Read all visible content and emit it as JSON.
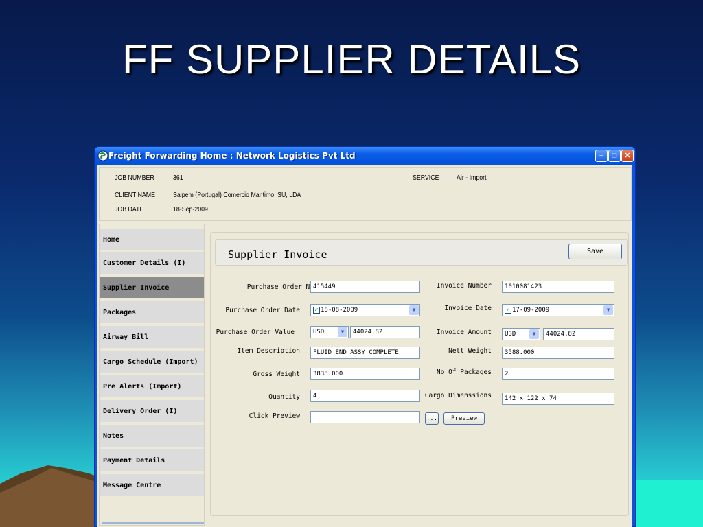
{
  "slide": {
    "title": "FF SUPPLIER DETAILS"
  },
  "window": {
    "title": "Freight Forwarding Home  :  Network Logistics Pvt Ltd",
    "minimize": "–",
    "maximize": "□",
    "close": "✕"
  },
  "job": {
    "number_label": "JOB NUMBER",
    "number": "361",
    "client_label": "CLIENT NAME",
    "client": "Saipem (Portugal) Comercio Maritimo, SU, LDA",
    "date_label": "JOB DATE",
    "date": "18-Sep-2009",
    "service_label": "SERVICE",
    "service": "Air - Import"
  },
  "sidebar": {
    "items": [
      {
        "label": "Home"
      },
      {
        "label": "Customer Details (I)"
      },
      {
        "label": "Supplier Invoice",
        "active": true
      },
      {
        "label": "Packages"
      },
      {
        "label": "Airway Bill"
      },
      {
        "label": "Cargo Schedule (Import)"
      },
      {
        "label": "Pre Alerts (Import)"
      },
      {
        "label": "Delivery Order (I)"
      },
      {
        "label": "Notes"
      },
      {
        "label": "Payment Details"
      },
      {
        "label": "Message Centre"
      }
    ]
  },
  "form": {
    "title": "Supplier Invoice",
    "save_label": "Save",
    "po_no_label": "Purchase Order No",
    "po_no": "415449",
    "po_date_label": "Purchase Order Date",
    "po_date": "18-08-2009",
    "po_value_label": "Purchase Order Value",
    "po_currency": "USD",
    "po_value": "44024.82",
    "item_desc_label": "Item Description",
    "item_desc": "FLUID END ASSY COMPLETE",
    "gross_weight_label": "Gross Weight",
    "gross_weight": "3838.000",
    "quantity_label": "Quantity",
    "quantity": "4",
    "click_preview_label": "Click Preview",
    "preview_path": "",
    "browse_label": "...",
    "preview_label": "Preview",
    "invoice_no_label": "Invoice Number",
    "invoice_no": "1010081423",
    "invoice_date_label": "Invoice Date",
    "invoice_date": "17-09-2009",
    "invoice_amount_label": "Invoice Amount",
    "invoice_currency": "USD",
    "invoice_amount": "44024.82",
    "nett_weight_label": "Nett Weight",
    "nett_weight": "3588.000",
    "packages_label": "No Of Packages",
    "packages": "2",
    "dimensions_label": "Cargo Dimenssions",
    "dimensions": "142 x 122 x 74"
  },
  "colors": {
    "active_nav": "#8c8c8c",
    "window_blue": "#0a54e0",
    "panel": "#ece9d8"
  }
}
